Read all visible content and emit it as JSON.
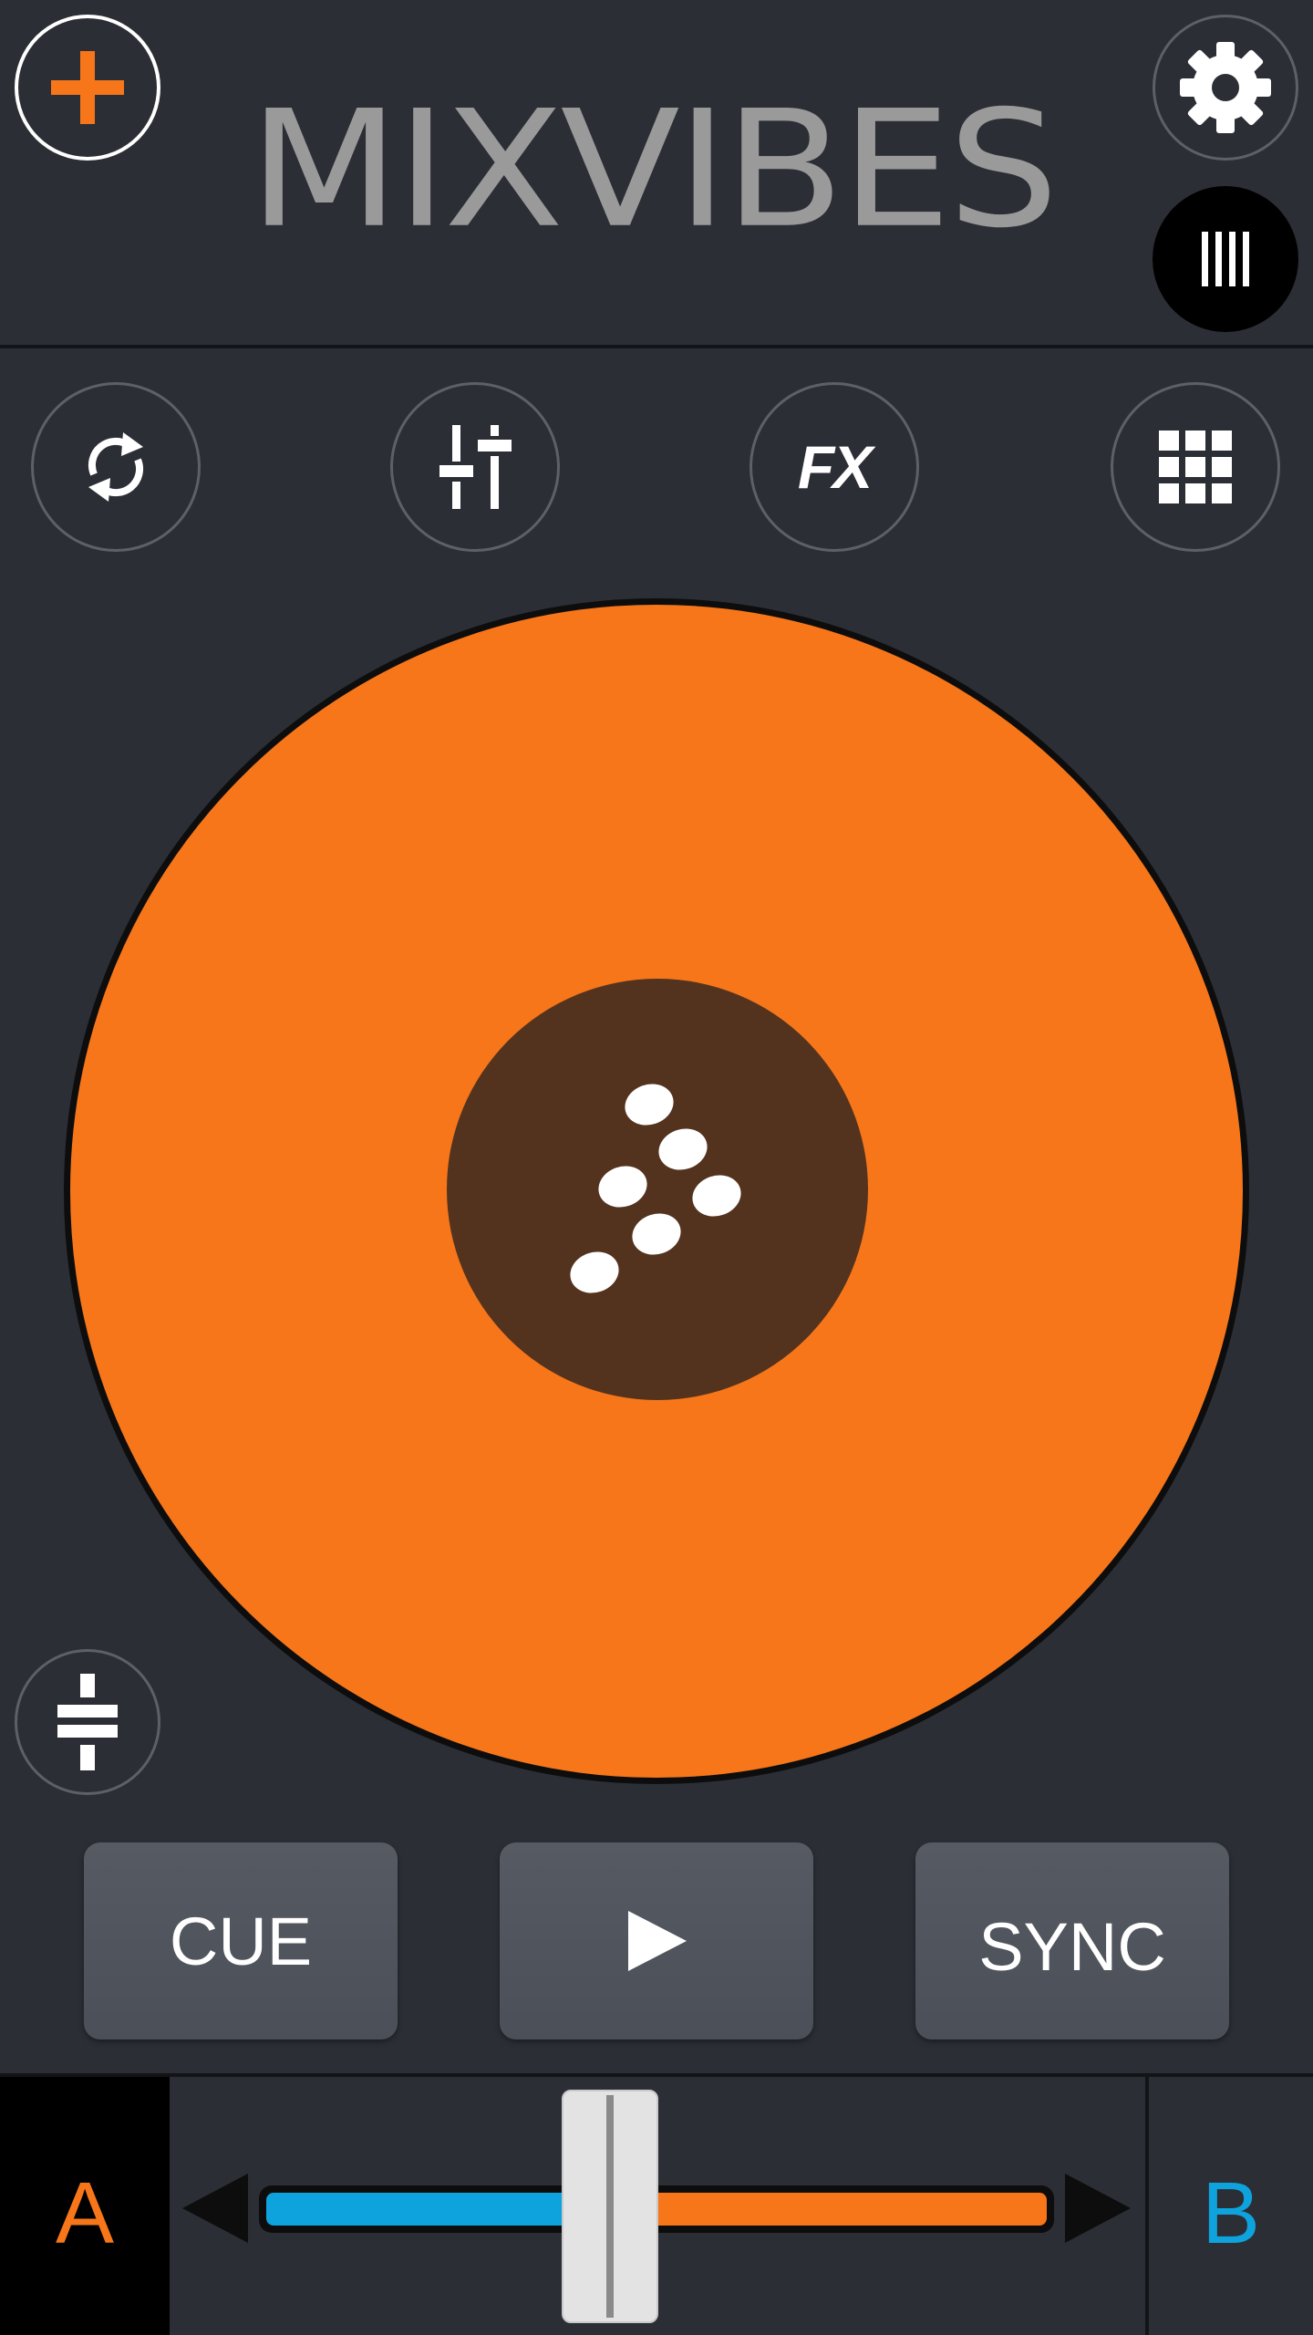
{
  "header": {
    "logo_text": "MIXVIBES",
    "add_icon": "plus-icon",
    "settings_icon": "gear-icon",
    "library_icon": "library-bars-icon"
  },
  "toolbar": {
    "loop_icon": "loop-icon",
    "mixer_icon": "mixer-sliders-icon",
    "fx_label": "FX",
    "pads_icon": "grid-pads-icon"
  },
  "turntable": {
    "platter_color": "#f7761a",
    "label_color": "#53331e",
    "label_icon": "mixvibes-dots-logo"
  },
  "pitch": {
    "icon": "pitch-fader-icon"
  },
  "transport": {
    "cue_label": "CUE",
    "play_icon": "play-icon",
    "sync_label": "SYNC"
  },
  "crossfader": {
    "deck_a_label": "A",
    "deck_b_label": "B",
    "position": 0.44,
    "deck_a_color": "#0ea3dc",
    "deck_b_color": "#f7761a"
  }
}
